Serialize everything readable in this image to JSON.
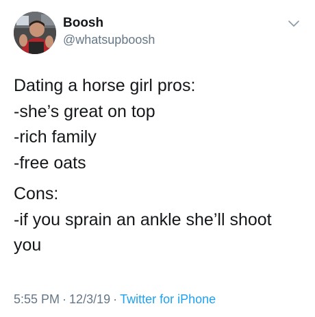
{
  "user": {
    "display_name": "Boosh",
    "handle": "@whatsupboosh"
  },
  "icons": {
    "avatar": "user-avatar-photo",
    "menu": "chevron-down-icon"
  },
  "tweet": {
    "lines_part1": [
      "Dating a horse girl pros:",
      "-she’s great on top",
      "-rich family",
      "-free oats"
    ],
    "lines_part2": [
      "Cons:",
      "-if you sprain an ankle she’ll shoot",
      "you"
    ]
  },
  "meta": {
    "time": "5:55 PM",
    "date": "12/3/19",
    "separator": "·",
    "source": "Twitter for iPhone"
  },
  "colors": {
    "text": "#14171a",
    "secondary": "#657786",
    "link": "#1da1f2"
  }
}
